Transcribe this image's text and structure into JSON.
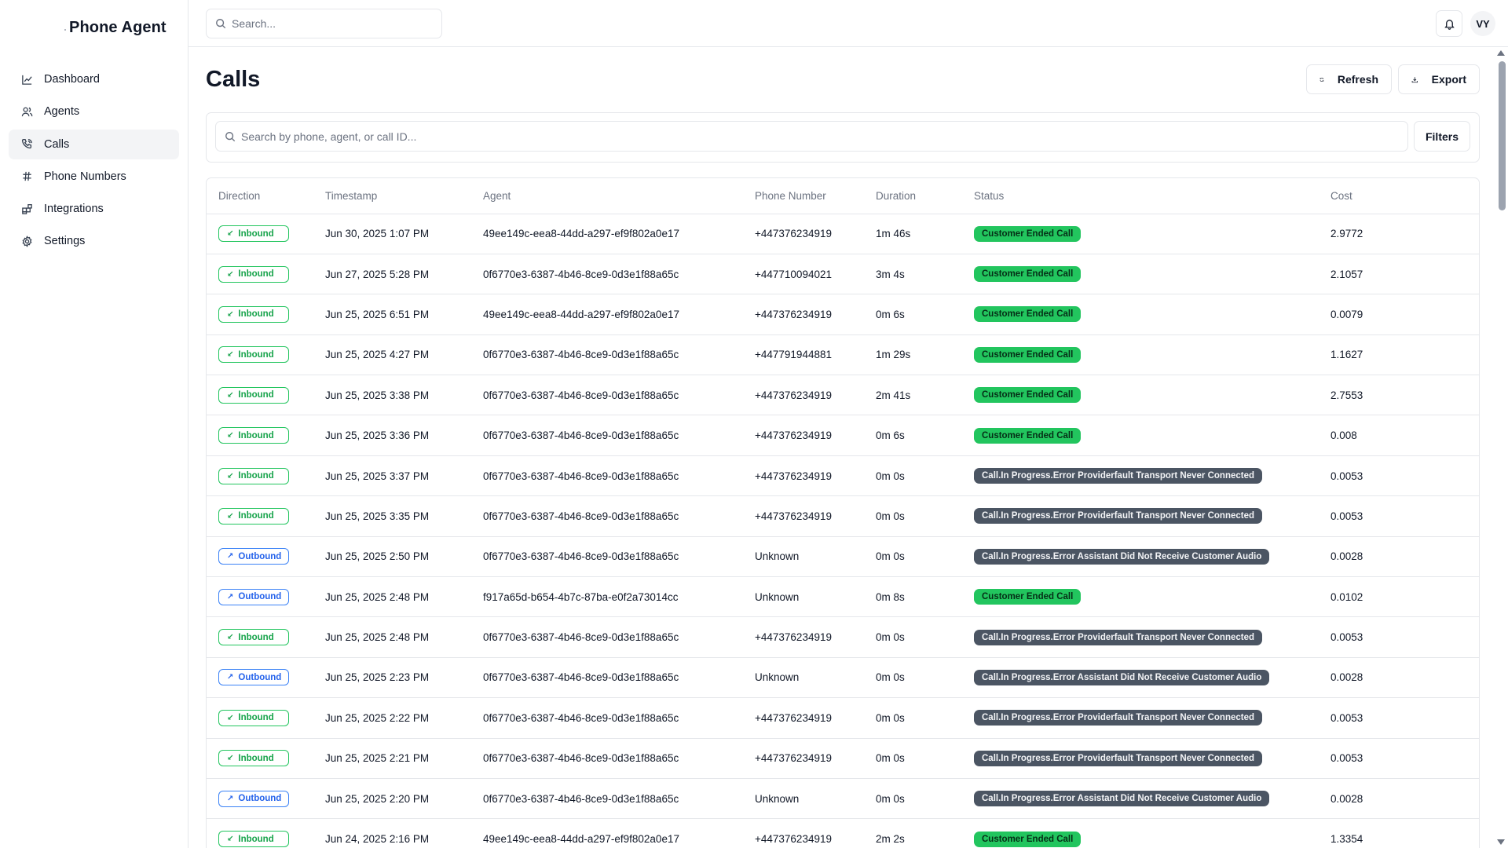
{
  "app": {
    "name": "Phone Agent"
  },
  "sidebar": {
    "items": [
      {
        "label": "Dashboard",
        "icon": "chart-line-icon",
        "active": false
      },
      {
        "label": "Agents",
        "icon": "users-icon",
        "active": false
      },
      {
        "label": "Calls",
        "icon": "phone-icon",
        "active": true
      },
      {
        "label": "Phone Numbers",
        "icon": "hash-icon",
        "active": false
      },
      {
        "label": "Integrations",
        "icon": "integrations-icon",
        "active": false
      },
      {
        "label": "Settings",
        "icon": "gear-icon",
        "active": false
      }
    ]
  },
  "topbar": {
    "search_placeholder": "Search...",
    "avatar_initials": "VY"
  },
  "page": {
    "title": "Calls",
    "refresh_label": "Refresh",
    "export_label": "Export",
    "table_search_placeholder": "Search by phone, agent, or call ID...",
    "filters_label": "Filters"
  },
  "table": {
    "columns": [
      "Direction",
      "Timestamp",
      "Agent",
      "Phone Number",
      "Duration",
      "Status",
      "Cost"
    ],
    "rows": [
      {
        "direction": "Inbound",
        "timestamp": "Jun 30, 2025 1:07 PM",
        "agent": "49ee149c-eea8-44dd-a297-ef9f802a0e17",
        "phone": "+447376234919",
        "duration": "1m 46s",
        "status": "Customer Ended Call",
        "status_kind": "ok",
        "cost": "2.9772"
      },
      {
        "direction": "Inbound",
        "timestamp": "Jun 27, 2025 5:28 PM",
        "agent": "0f6770e3-6387-4b46-8ce9-0d3e1f88a65c",
        "phone": "+447710094021",
        "duration": "3m 4s",
        "status": "Customer Ended Call",
        "status_kind": "ok",
        "cost": "2.1057"
      },
      {
        "direction": "Inbound",
        "timestamp": "Jun 25, 2025 6:51 PM",
        "agent": "49ee149c-eea8-44dd-a297-ef9f802a0e17",
        "phone": "+447376234919",
        "duration": "0m 6s",
        "status": "Customer Ended Call",
        "status_kind": "ok",
        "cost": "0.0079"
      },
      {
        "direction": "Inbound",
        "timestamp": "Jun 25, 2025 4:27 PM",
        "agent": "0f6770e3-6387-4b46-8ce9-0d3e1f88a65c",
        "phone": "+447791944881",
        "duration": "1m 29s",
        "status": "Customer Ended Call",
        "status_kind": "ok",
        "cost": "1.1627"
      },
      {
        "direction": "Inbound",
        "timestamp": "Jun 25, 2025 3:38 PM",
        "agent": "0f6770e3-6387-4b46-8ce9-0d3e1f88a65c",
        "phone": "+447376234919",
        "duration": "2m 41s",
        "status": "Customer Ended Call",
        "status_kind": "ok",
        "cost": "2.7553"
      },
      {
        "direction": "Inbound",
        "timestamp": "Jun 25, 2025 3:36 PM",
        "agent": "0f6770e3-6387-4b46-8ce9-0d3e1f88a65c",
        "phone": "+447376234919",
        "duration": "0m 6s",
        "status": "Customer Ended Call",
        "status_kind": "ok",
        "cost": "0.008"
      },
      {
        "direction": "Inbound",
        "timestamp": "Jun 25, 2025 3:37 PM",
        "agent": "0f6770e3-6387-4b46-8ce9-0d3e1f88a65c",
        "phone": "+447376234919",
        "duration": "0m 0s",
        "status": "Call.In Progress.Error Providerfault Transport Never Connected",
        "status_kind": "err",
        "cost": "0.0053"
      },
      {
        "direction": "Inbound",
        "timestamp": "Jun 25, 2025 3:35 PM",
        "agent": "0f6770e3-6387-4b46-8ce9-0d3e1f88a65c",
        "phone": "+447376234919",
        "duration": "0m 0s",
        "status": "Call.In Progress.Error Providerfault Transport Never Connected",
        "status_kind": "err",
        "cost": "0.0053"
      },
      {
        "direction": "Outbound",
        "timestamp": "Jun 25, 2025 2:50 PM",
        "agent": "0f6770e3-6387-4b46-8ce9-0d3e1f88a65c",
        "phone": "Unknown",
        "duration": "0m 0s",
        "status": "Call.In Progress.Error Assistant Did Not Receive Customer Audio",
        "status_kind": "err",
        "cost": "0.0028"
      },
      {
        "direction": "Outbound",
        "timestamp": "Jun 25, 2025 2:48 PM",
        "agent": "f917a65d-b654-4b7c-87ba-e0f2a73014cc",
        "phone": "Unknown",
        "duration": "0m 8s",
        "status": "Customer Ended Call",
        "status_kind": "ok",
        "cost": "0.0102"
      },
      {
        "direction": "Inbound",
        "timestamp": "Jun 25, 2025 2:48 PM",
        "agent": "0f6770e3-6387-4b46-8ce9-0d3e1f88a65c",
        "phone": "+447376234919",
        "duration": "0m 0s",
        "status": "Call.In Progress.Error Providerfault Transport Never Connected",
        "status_kind": "err",
        "cost": "0.0053"
      },
      {
        "direction": "Outbound",
        "timestamp": "Jun 25, 2025 2:23 PM",
        "agent": "0f6770e3-6387-4b46-8ce9-0d3e1f88a65c",
        "phone": "Unknown",
        "duration": "0m 0s",
        "status": "Call.In Progress.Error Assistant Did Not Receive Customer Audio",
        "status_kind": "err",
        "cost": "0.0028"
      },
      {
        "direction": "Inbound",
        "timestamp": "Jun 25, 2025 2:22 PM",
        "agent": "0f6770e3-6387-4b46-8ce9-0d3e1f88a65c",
        "phone": "+447376234919",
        "duration": "0m 0s",
        "status": "Call.In Progress.Error Providerfault Transport Never Connected",
        "status_kind": "err",
        "cost": "0.0053"
      },
      {
        "direction": "Inbound",
        "timestamp": "Jun 25, 2025 2:21 PM",
        "agent": "0f6770e3-6387-4b46-8ce9-0d3e1f88a65c",
        "phone": "+447376234919",
        "duration": "0m 0s",
        "status": "Call.In Progress.Error Providerfault Transport Never Connected",
        "status_kind": "err",
        "cost": "0.0053"
      },
      {
        "direction": "Outbound",
        "timestamp": "Jun 25, 2025 2:20 PM",
        "agent": "0f6770e3-6387-4b46-8ce9-0d3e1f88a65c",
        "phone": "Unknown",
        "duration": "0m 0s",
        "status": "Call.In Progress.Error Assistant Did Not Receive Customer Audio",
        "status_kind": "err",
        "cost": "0.0028"
      },
      {
        "direction": "Inbound",
        "timestamp": "Jun 24, 2025 2:16 PM",
        "agent": "49ee149c-eea8-44dd-a297-ef9f802a0e17",
        "phone": "+447376234919",
        "duration": "2m 2s",
        "status": "Customer Ended Call",
        "status_kind": "ok",
        "cost": "1.3354"
      }
    ]
  },
  "colors": {
    "inbound": "#16a34a",
    "outbound": "#2563eb",
    "status_ok": "#22c55e",
    "status_err": "#4b5563"
  }
}
